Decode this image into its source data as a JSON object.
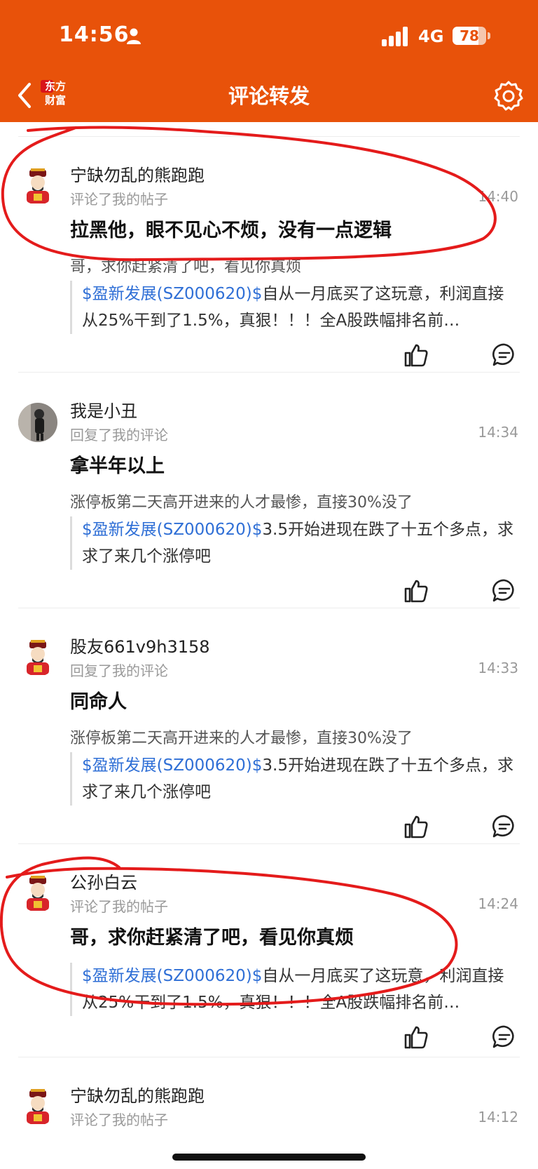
{
  "status_bar": {
    "time": "14:56",
    "network": "4G",
    "battery": "78",
    "battery_level": 0.78
  },
  "header": {
    "title": "评论转发",
    "logo_line1": "东方",
    "logo_line2": "财富",
    "back_icon": "chevron-left-icon",
    "settings_icon": "gear-icon",
    "background_color": "#e8520a"
  },
  "feed": {
    "items": [
      {
        "username": "宁缺勿乱的熊跑跑",
        "action": "评论了我的帖子",
        "time": "14:40",
        "content": "拉黑他，眼不见心不烦，没有一点逻辑",
        "subtext": "哥，求你赶紧清了吧，看见你真烦",
        "quote_stock": "$盈新发展(SZ000620)$",
        "quote_text": "自从一月底买了这玩意，利润直接从25%干到了1.5%，真狠！！！全A股跌幅排名前…"
      },
      {
        "username": "我是小丑",
        "action": "回复了我的评论",
        "time": "14:34",
        "content": "拿半年以上",
        "subtext": "涨停板第二天高开进来的人才最惨，直接30%没了",
        "quote_stock": "$盈新发展(SZ000620)$",
        "quote_text": "3.5开始进现在跌了十五个多点，求求了来几个涨停吧"
      },
      {
        "username": "股友661v9h3158",
        "action": "回复了我的评论",
        "time": "14:33",
        "content": "同命人",
        "subtext": "涨停板第二天高开进来的人才最惨，直接30%没了",
        "quote_stock": "$盈新发展(SZ000620)$",
        "quote_text": "3.5开始进现在跌了十五个多点，求求了来几个涨停吧"
      },
      {
        "username": "公孙白云",
        "action": "评论了我的帖子",
        "time": "14:24",
        "content": "哥，求你赶紧清了吧，看见你真烦",
        "quote_stock": "$盈新发展(SZ000620)$",
        "quote_text": "自从一月底买了这玩意，利润直接从25%干到了1.5%，真狠！！！全A股跌幅排名前…"
      },
      {
        "username": "宁缺勿乱的熊跑跑",
        "action": "评论了我的帖子",
        "time": "14:12"
      }
    ],
    "stock_color": "#2f6fd6"
  },
  "icons": {
    "like": "thumbs-up-icon",
    "comment": "comment-icon",
    "avatar": "fortune-god-avatar"
  }
}
